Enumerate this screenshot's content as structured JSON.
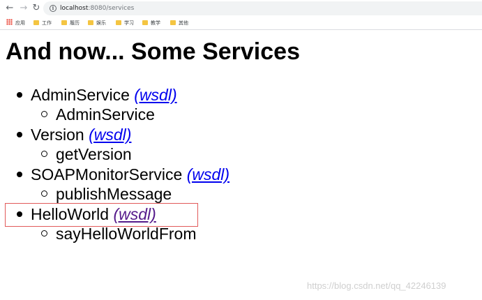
{
  "browser": {
    "url_host": "localhost",
    "url_rest": ":8080/services",
    "bookmarks": [
      {
        "label": "应用",
        "icon": "apps-grid-icon"
      },
      {
        "label": "工作",
        "icon": "folder-icon"
      },
      {
        "label": "履历",
        "icon": "folder-icon"
      },
      {
        "label": "娱乐",
        "icon": "folder-icon"
      },
      {
        "label": "学习",
        "icon": "folder-icon"
      },
      {
        "label": "教学",
        "icon": "folder-icon"
      },
      {
        "label": "其他",
        "icon": "folder-icon"
      }
    ]
  },
  "page": {
    "title": "And now... Some Services",
    "wsdl_label": "(wsdl)",
    "services": [
      {
        "name": "AdminService",
        "method": "AdminService",
        "visited": false
      },
      {
        "name": "Version",
        "method": "getVersion",
        "visited": false
      },
      {
        "name": "SOAPMonitorService",
        "method": "publishMessage",
        "visited": false
      },
      {
        "name": "HelloWorld",
        "method": "sayHelloWorldFrom",
        "visited": true
      }
    ]
  },
  "watermark": "https://blog.csdn.net/qq_42246139",
  "colors": {
    "link": "#0000ee",
    "visited_link": "#551a8b",
    "highlight_box": "#e15a5a"
  }
}
